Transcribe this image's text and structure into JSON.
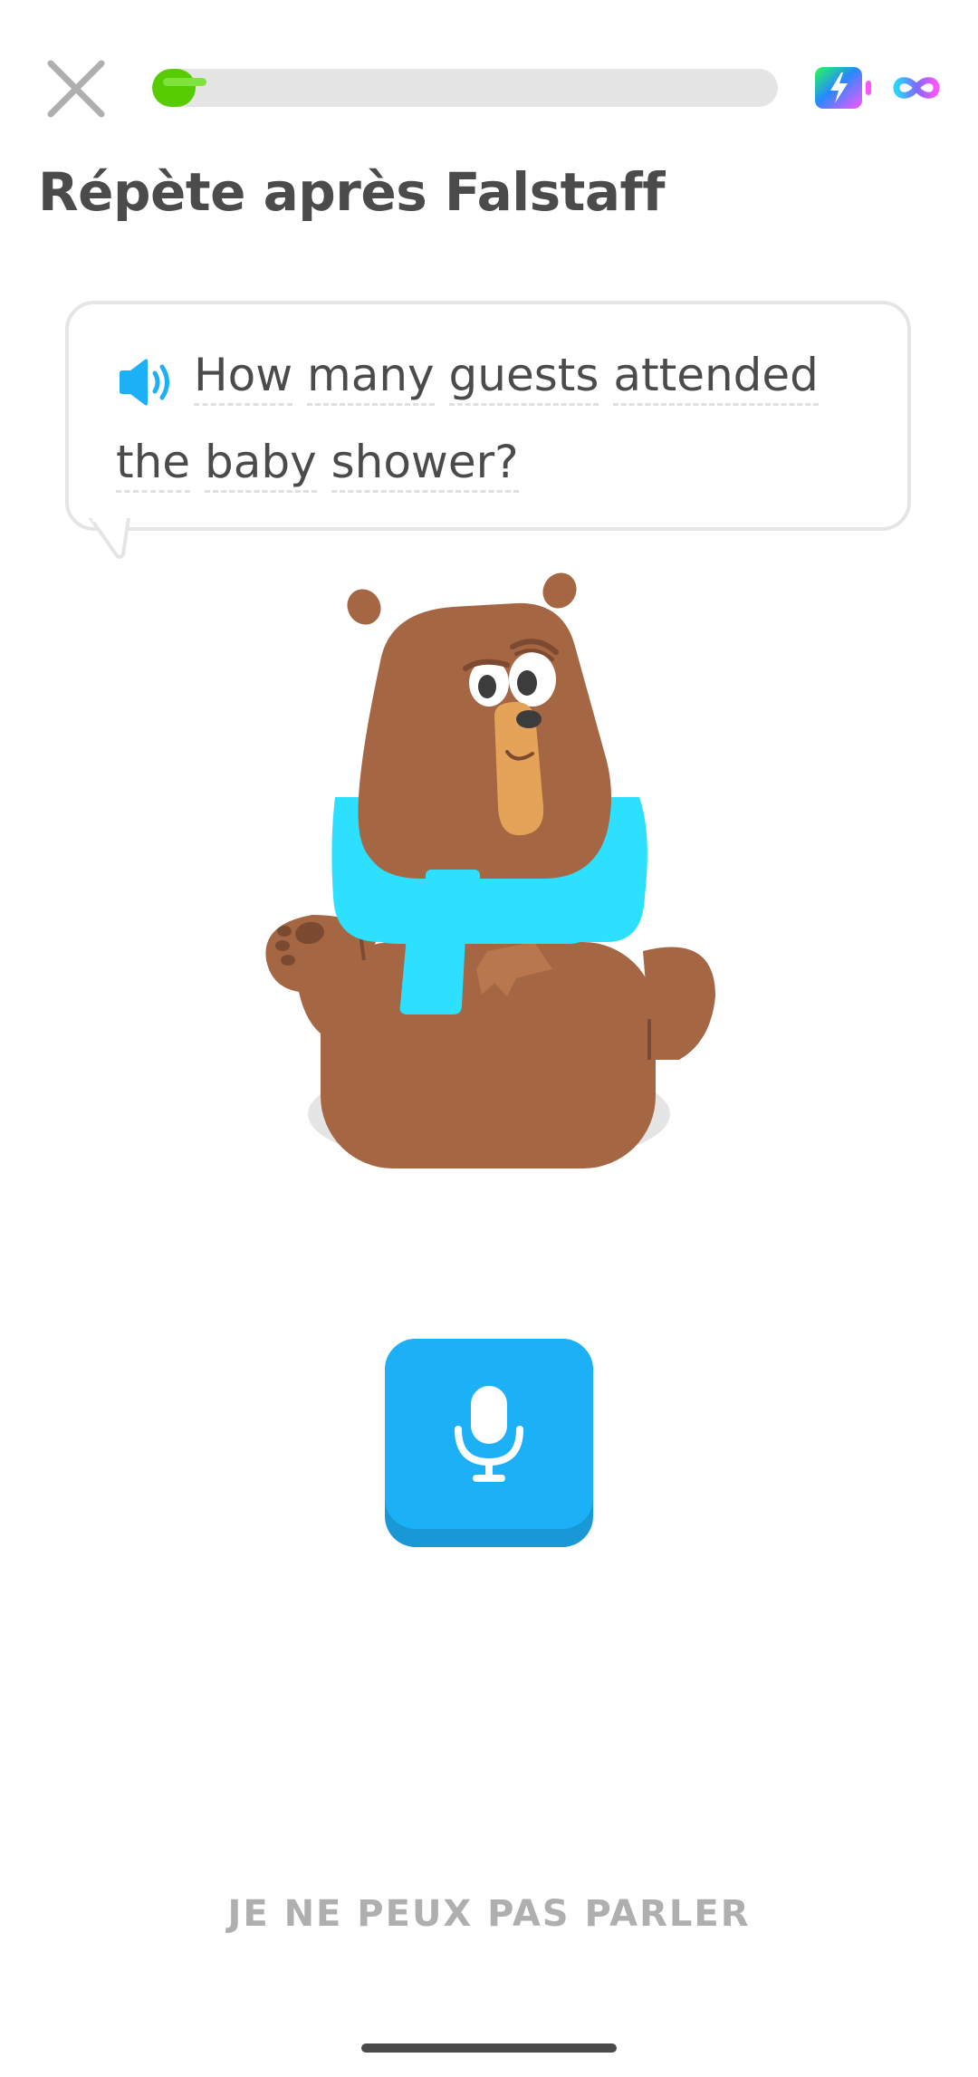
{
  "header": {
    "close_icon": "close-icon",
    "progress_fraction": 0.07,
    "progress_color": "#58cc02",
    "track_color": "#e5e5e5",
    "super_icon": "super-lightning-icon",
    "hearts_icon": "infinity-icon"
  },
  "title": "Répète après Falstaff",
  "prompt": {
    "speaker_icon": "speaker-icon",
    "words": [
      "How",
      "many",
      "guests",
      "attended",
      "the",
      "baby",
      "shower?"
    ]
  },
  "character": {
    "name_icon": "bear-character"
  },
  "mic_button": {
    "icon": "microphone-icon",
    "color": "#1cb0f6"
  },
  "footer": {
    "cant_speak_label": "JE NE PEUX PAS PARLER"
  }
}
